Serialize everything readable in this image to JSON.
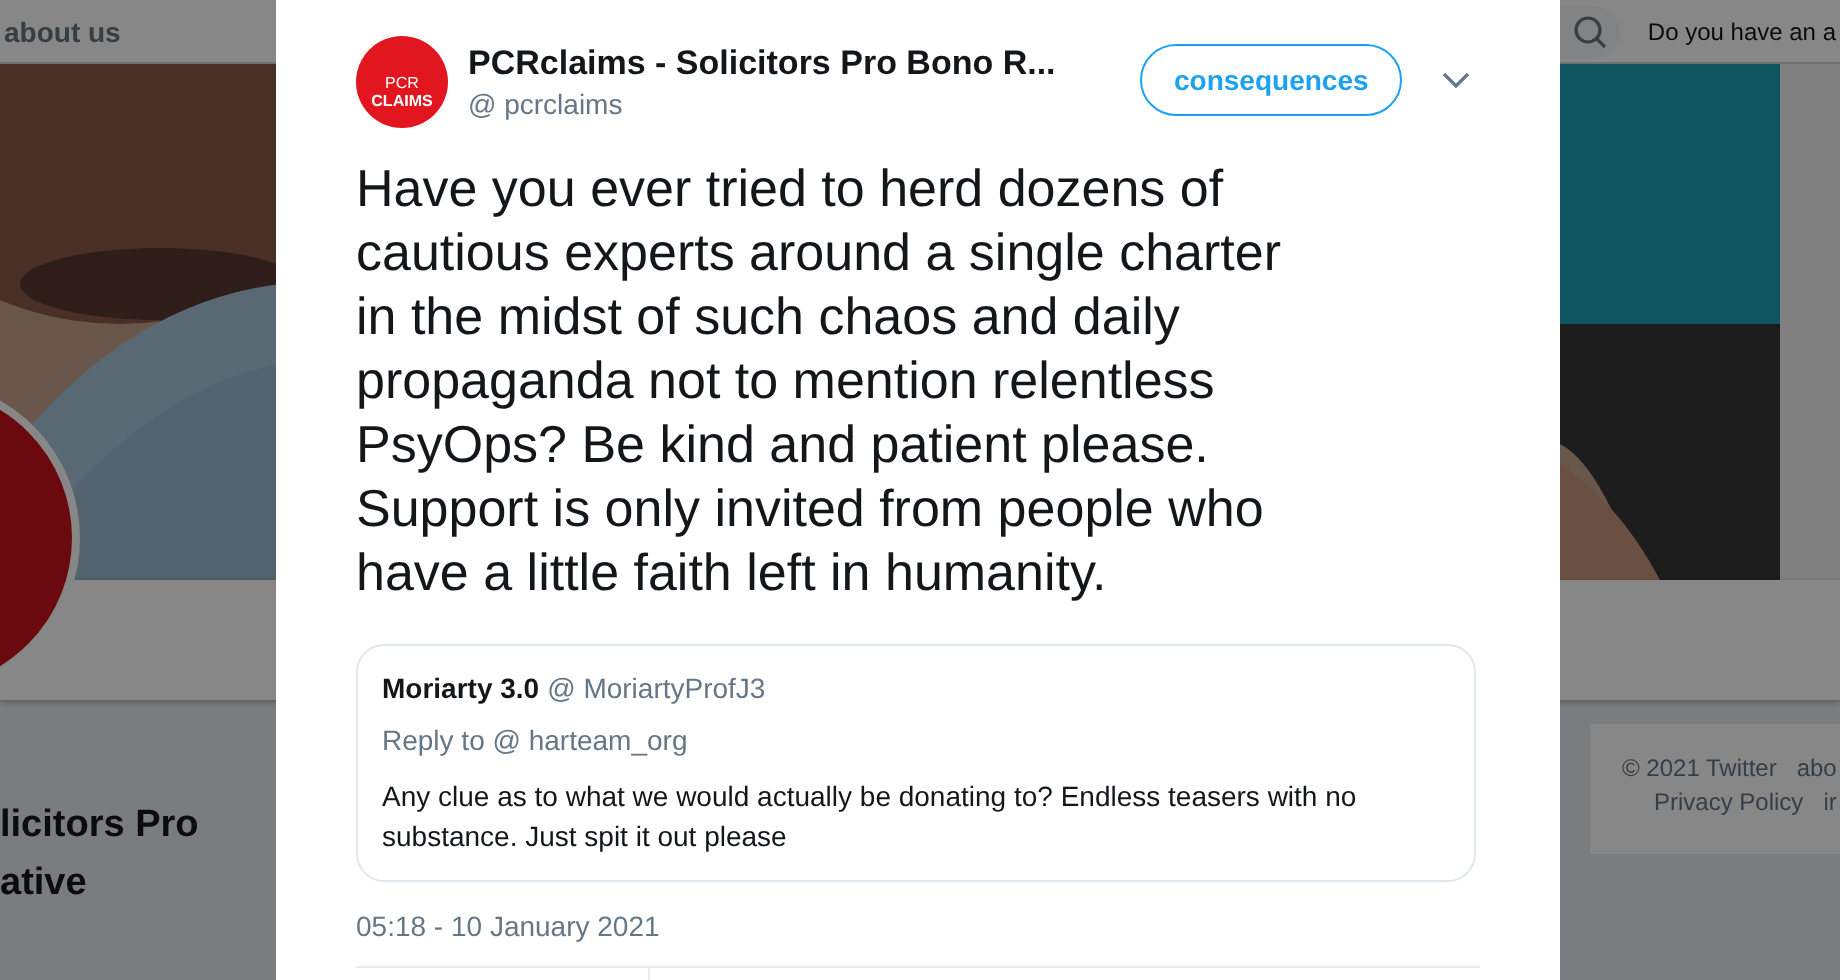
{
  "background": {
    "nav_link": "about us",
    "search_prompt": "Do you have an a",
    "profile_name_lines": [
      "licitors Pro",
      "ative"
    ],
    "footer_lines": [
      [
        "© 2021 Twitter",
        "abo"
      ],
      [
        "Privacy Policy",
        "ir"
      ]
    ]
  },
  "tweet": {
    "logo_top": "PCR",
    "logo_bottom": "CLAIMS",
    "author": "PCRclaims - Solicitors Pro Bono R...",
    "handle": "@ pcrclaims",
    "follow_button": "consequences",
    "text": "Have you ever tried to herd dozens of cautious experts around a single charter in the midst of such chaos and daily propaganda not to mention relentless PsyOps? Be kind and patient please. Support is only invited from people who have a little faith left in humanity.",
    "quote": {
      "author": "Moriarty 3.0",
      "handle": "@ MoriartyProfJ3",
      "reply_to": "Reply to @ harteam_org",
      "text": "Any clue as to what we would actually be donating to? Endless teasers with no substance. Just spit it out please"
    },
    "timestamp": "05:18 - 10 January 2021"
  }
}
